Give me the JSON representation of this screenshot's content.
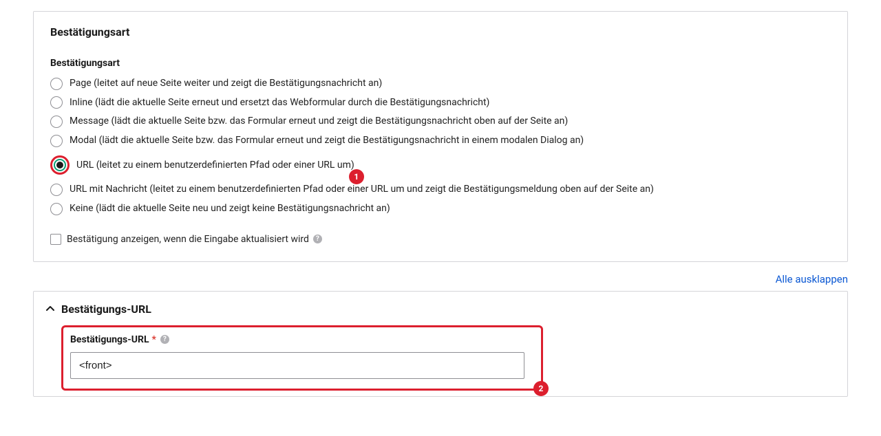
{
  "panel1": {
    "title": "Bestätigungsart",
    "field_label": "Bestätigungsart",
    "options": {
      "page": "Page (leitet auf neue Seite weiter und zeigt die Bestätigungsnachricht an)",
      "inline": "Inline (lädt die aktuelle Seite erneut und ersetzt das Webformular durch die Bestätigungsnachricht)",
      "message": "Message (lädt die aktuelle Seite bzw. das Formular erneut und zeigt die Bestätigungsnachricht oben auf der Seite an)",
      "modal": "Modal (lädt die aktuelle Seite bzw. das Formular erneut und zeigt die Bestätigungsnachricht in einem modalen Dialog an)",
      "url": "URL (leitet zu einem benutzerdefinierten Pfad oder einer URL um)",
      "url_msg": "URL mit Nachricht (leitet zu einem benutzerdefinierten Pfad oder einer URL um und zeigt die Bestätigungsmeldung oben auf der Seite an)",
      "none": "Keine (lädt die aktuelle Seite neu und zeigt keine Bestätigungsnachricht an)"
    },
    "checkbox_label": "Bestätigung anzeigen, wenn die Eingabe aktualisiert wird"
  },
  "expand_all": "Alle ausklappen",
  "panel2": {
    "title": "Bestätigungs-URL",
    "field_label": "Bestätigungs-URL",
    "input_value": "<front>"
  },
  "annotations": {
    "badge1": "1",
    "badge2": "2"
  },
  "help_glyph": "?"
}
